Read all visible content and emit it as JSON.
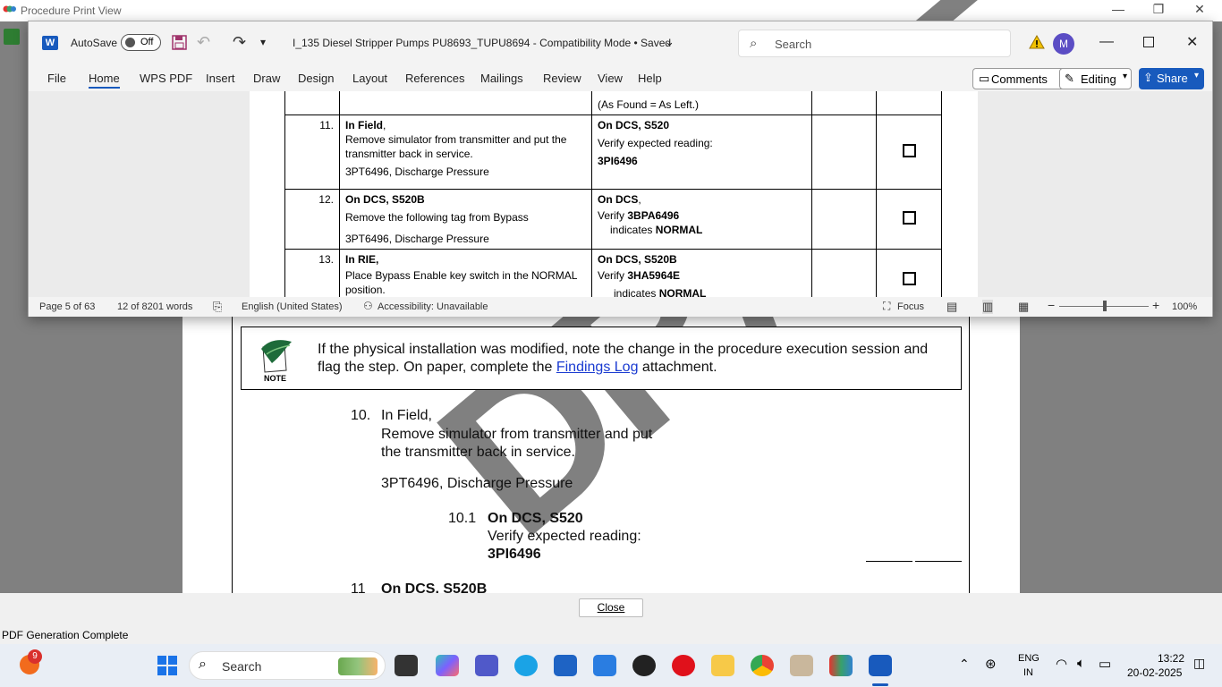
{
  "print_view": {
    "title": "Procedure Print View",
    "note": {
      "text_before": "If the physical installation was modified, note the change in the procedure execution session and flag the step. On paper, complete the ",
      "link": "Findings Log",
      "text_after": " attachment.",
      "label": "NOTE"
    },
    "step10": {
      "num": "10.",
      "l1": "In Field,",
      "l2": "Remove simulator from transmitter and put",
      "l3": "the transmitter back in service.",
      "l4": "3PT6496, Discharge Pressure"
    },
    "step10_1": {
      "num": "10.1",
      "l1": "On DCS, S520",
      "l2": "Verify expected reading:",
      "l3": "3PI6496"
    },
    "step11": {
      "num": "11",
      "l1": "On DCS, S520B"
    },
    "watermark": "DRAFT",
    "close_label": "Close",
    "status": "PDF Generation Complete"
  },
  "word": {
    "autosave_label": "AutoSave",
    "autosave_state": "Off",
    "doc_title": "I_135 Diesel Stripper Pumps PU8693_TUPU8694  -  Compatibility Mode  •  Saved",
    "search_placeholder": "Search",
    "avatar_initial": "M",
    "menu": [
      "File",
      "Home",
      "WPS PDF",
      "Insert",
      "Draw",
      "Design",
      "Layout",
      "References",
      "Mailings",
      "Review",
      "View",
      "Help"
    ],
    "comments_label": "Comments",
    "editing_label": "Editing",
    "share_label": "Share",
    "table": {
      "top_fragment": "(As Found = As Left.)",
      "rows": [
        {
          "num": "11.",
          "a_bold": "In Field",
          "a_rest": ",",
          "a2": "Remove simulator from transmitter and put the transmitter back in service.",
          "a3": "3PT6496, Discharge Pressure",
          "b1": "On DCS, S520",
          "b2": "Verify expected reading:",
          "b3": "3PI6496"
        },
        {
          "num": "12.",
          "a_bold": "On DCS, S520B",
          "a_rest": "",
          "a2": "Remove the following tag from Bypass",
          "a3": "3PT6496, Discharge Pressure",
          "b1": "On DCS",
          "b1_rest": ",",
          "b2": "Verify ",
          "b2_bold": "3BPA6496",
          "b3": "indicates ",
          "b3_bold": "NORMAL"
        },
        {
          "num": "13.",
          "a_bold": "In RIE,",
          "a_rest": "",
          "a2": "Place Bypass Enable key switch in the NORMAL position.",
          "a3": "",
          "b1": "On DCS, S520B",
          "b2": "Verify ",
          "b2_bold": "3HA5964E",
          "b3": "indicates ",
          "b3_bold": "NORMAL"
        }
      ]
    },
    "status": {
      "page": "Page 5 of 63",
      "words": "12 of 8201 words",
      "language": "English (United States)",
      "accessibility": "Accessibility: Unavailable",
      "focus": "Focus",
      "zoom": "100%",
      "zoom_level": 1.0
    }
  },
  "taskbar": {
    "search_label": "Search",
    "notif_count": "9",
    "lang1": "ENG",
    "lang2": "IN",
    "time": "13:22",
    "date": "20-02-2025"
  }
}
